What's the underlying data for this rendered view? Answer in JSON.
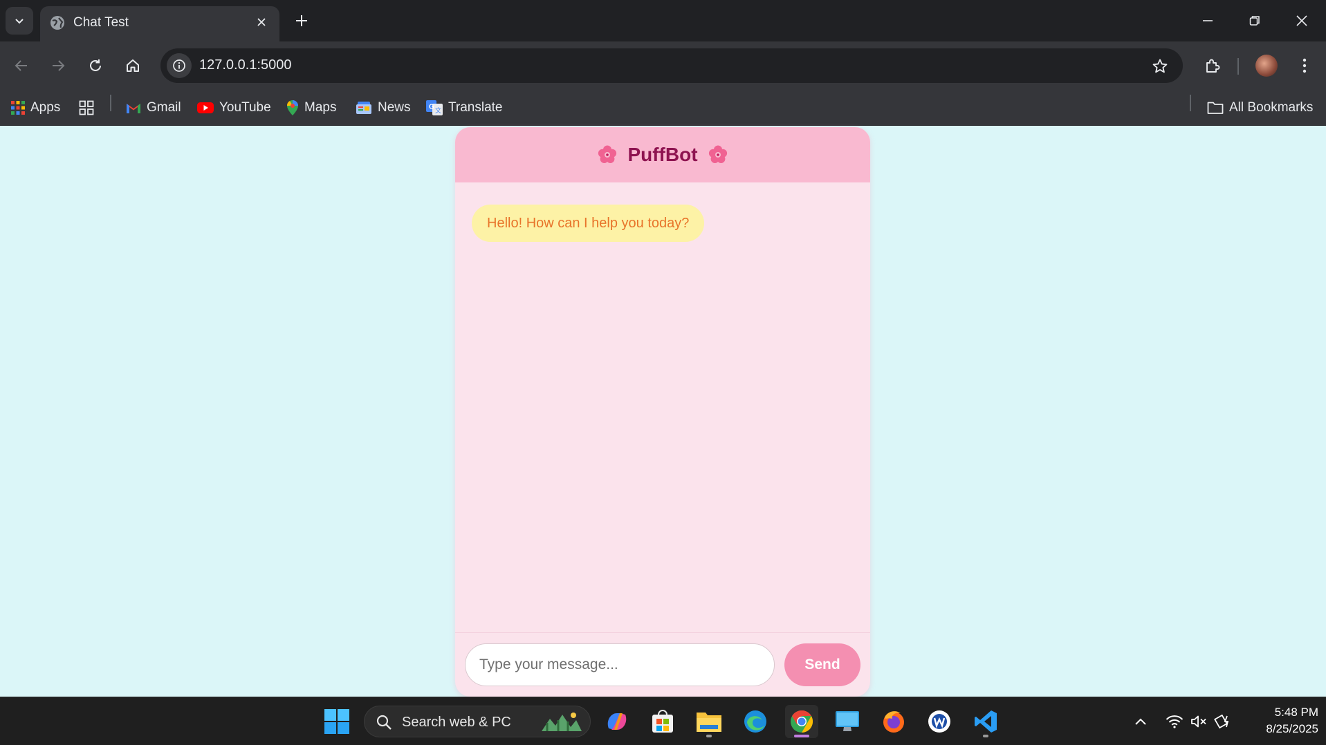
{
  "browser": {
    "tab_title": "Chat Test",
    "url": "127.0.0.1:5000",
    "bookmarks": [
      {
        "label": "Apps",
        "icon": "apps-grid-icon"
      },
      {
        "label": "Gmail",
        "icon": "gmail-icon"
      },
      {
        "label": "YouTube",
        "icon": "youtube-icon"
      },
      {
        "label": "Maps",
        "icon": "maps-icon"
      },
      {
        "label": "News",
        "icon": "news-icon"
      },
      {
        "label": "Translate",
        "icon": "translate-icon"
      }
    ],
    "all_bookmarks": "All Bookmarks"
  },
  "chat": {
    "title": "PuffBot",
    "messages": [
      {
        "sender": "bot",
        "text": "Hello! How can I help you today?"
      }
    ],
    "input_placeholder": "Type your message...",
    "send_label": "Send",
    "colors": {
      "page_bg": "#dbf6f8",
      "header_bg": "#f9b9d0",
      "title": "#8e1350",
      "body_bg": "#fbe3ec",
      "bot_bubble": "#fdf2a6",
      "bot_text": "#e8742a",
      "send_button": "#f48fb1"
    }
  },
  "taskbar": {
    "search_label": "Search web & PC",
    "time": "5:48 PM",
    "date": "8/25/2025"
  }
}
